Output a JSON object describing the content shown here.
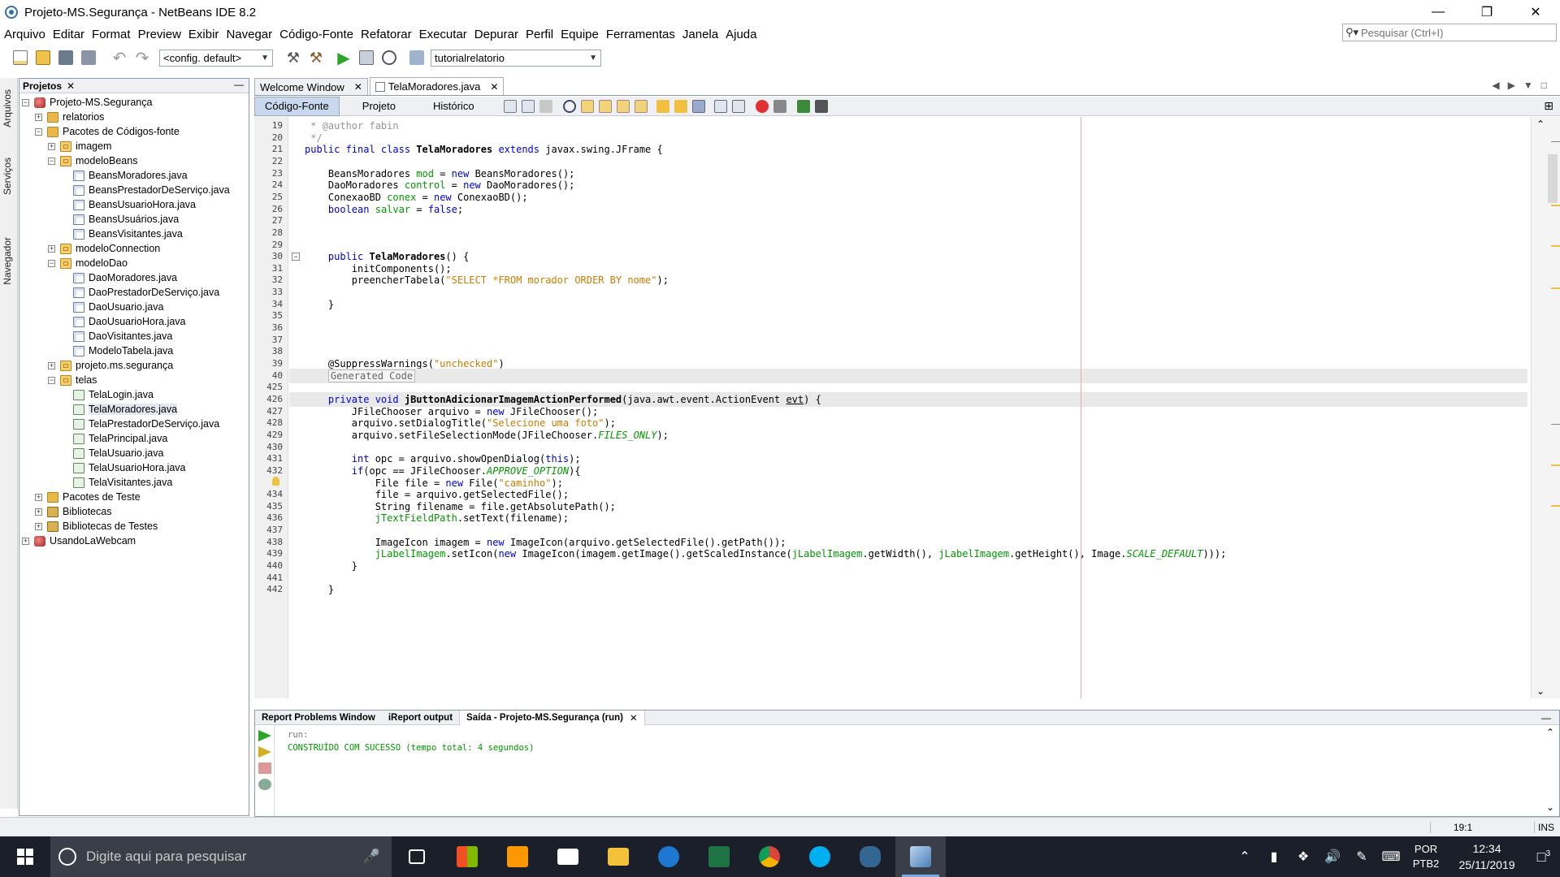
{
  "window": {
    "title": "Projeto-MS.Segurança - NetBeans IDE 8.2",
    "controls": [
      "—",
      "❐",
      "✕"
    ]
  },
  "menu": [
    "Arquivo",
    "Editar",
    "Format",
    "Preview",
    "Exibir",
    "Navegar",
    "Código-Fonte",
    "Refatorar",
    "Executar",
    "Depurar",
    "Perfil",
    "Equipe",
    "Ferramentas",
    "Janela",
    "Ajuda"
  ],
  "search": {
    "placeholder": "Pesquisar (Ctrl+I)"
  },
  "toolbar": {
    "config": "<config. default>",
    "project_combo": "tutorialrelatorio"
  },
  "side_tabs": [
    "Arquivos",
    "Serviços",
    "Navegador"
  ],
  "projects_panel": {
    "title": "Projetos",
    "close": "✕",
    "tree": [
      {
        "label": "Projeto-MS.Segurança",
        "depth": 0,
        "exp": "−",
        "icon": "proj"
      },
      {
        "label": "relatorios",
        "depth": 1,
        "exp": "+",
        "icon": "fold"
      },
      {
        "label": "Pacotes de Códigos-fonte",
        "depth": 1,
        "exp": "−",
        "icon": "fold"
      },
      {
        "label": "imagem",
        "depth": 2,
        "exp": "+",
        "icon": "pkg"
      },
      {
        "label": "modeloBeans",
        "depth": 2,
        "exp": "−",
        "icon": "pkg"
      },
      {
        "label": "BeansMoradores.java",
        "depth": 3,
        "exp": "",
        "icon": "java"
      },
      {
        "label": "BeansPrestadorDeServiço.java",
        "depth": 3,
        "exp": "",
        "icon": "java"
      },
      {
        "label": "BeansUsuarioHora.java",
        "depth": 3,
        "exp": "",
        "icon": "java"
      },
      {
        "label": "BeansUsuários.java",
        "depth": 3,
        "exp": "",
        "icon": "java"
      },
      {
        "label": "BeansVisitantes.java",
        "depth": 3,
        "exp": "",
        "icon": "java"
      },
      {
        "label": "modeloConnection",
        "depth": 2,
        "exp": "+",
        "icon": "pkg"
      },
      {
        "label": "modeloDao",
        "depth": 2,
        "exp": "−",
        "icon": "pkg"
      },
      {
        "label": "DaoMoradores.java",
        "depth": 3,
        "exp": "",
        "icon": "java"
      },
      {
        "label": "DaoPrestadorDeServiço.java",
        "depth": 3,
        "exp": "",
        "icon": "java"
      },
      {
        "label": "DaoUsuario.java",
        "depth": 3,
        "exp": "",
        "icon": "java"
      },
      {
        "label": "DaoUsuarioHora.java",
        "depth": 3,
        "exp": "",
        "icon": "java"
      },
      {
        "label": "DaoVisitantes.java",
        "depth": 3,
        "exp": "",
        "icon": "java"
      },
      {
        "label": "ModeloTabela.java",
        "depth": 3,
        "exp": "",
        "icon": "java"
      },
      {
        "label": "projeto.ms.segurança",
        "depth": 2,
        "exp": "+",
        "icon": "pkg"
      },
      {
        "label": "telas",
        "depth": 2,
        "exp": "−",
        "icon": "pkg"
      },
      {
        "label": "TelaLogin.java",
        "depth": 3,
        "exp": "",
        "icon": "form"
      },
      {
        "label": "TelaMoradores.java",
        "depth": 3,
        "exp": "",
        "icon": "form",
        "selected": true
      },
      {
        "label": "TelaPrestadorDeServiço.java",
        "depth": 3,
        "exp": "",
        "icon": "form"
      },
      {
        "label": "TelaPrincipal.java",
        "depth": 3,
        "exp": "",
        "icon": "form"
      },
      {
        "label": "TelaUsuario.java",
        "depth": 3,
        "exp": "",
        "icon": "form"
      },
      {
        "label": "TelaUsuarioHora.java",
        "depth": 3,
        "exp": "",
        "icon": "form"
      },
      {
        "label": "TelaVisitantes.java",
        "depth": 3,
        "exp": "",
        "icon": "form"
      },
      {
        "label": "Pacotes de Teste",
        "depth": 1,
        "exp": "+",
        "icon": "fold"
      },
      {
        "label": "Bibliotecas",
        "depth": 1,
        "exp": "+",
        "icon": "lib"
      },
      {
        "label": "Bibliotecas de Testes",
        "depth": 1,
        "exp": "+",
        "icon": "lib"
      },
      {
        "label": "UsandoLaWebcam",
        "depth": 0,
        "exp": "+",
        "icon": "proj"
      }
    ]
  },
  "editor": {
    "tabs": [
      {
        "label": "Welcome Window",
        "close": "✕"
      },
      {
        "label": "TelaMoradores.java",
        "close": "✕",
        "active": true
      }
    ],
    "subtabs": [
      "Código-Fonte",
      "Projeto",
      "Histórico"
    ],
    "fold_marks": {
      "30": "−",
      "40": "+",
      "426": "−"
    },
    "lines": [
      {
        "n": "19",
        "html": "<span class='cm'> * @author fabin</span>"
      },
      {
        "n": "20",
        "html": "<span class='cm'> */</span>"
      },
      {
        "n": "21",
        "html": "<span class='kw'>public final class</span> <b>TelaMoradores</b> <span class='kw'>extends</span> javax.swing.JFrame {"
      },
      {
        "n": "22",
        "html": ""
      },
      {
        "n": "23",
        "html": "    BeansMoradores <span class='gf'>mod</span> = <span class='kw'>new</span> BeansMoradores();"
      },
      {
        "n": "24",
        "html": "    DaoMoradores <span class='gf'>control</span> = <span class='kw'>new</span> DaoMoradores();"
      },
      {
        "n": "25",
        "html": "    ConexaoBD <span class='gf'>conex</span> = <span class='kw'>new</span> ConexaoBD();"
      },
      {
        "n": "26",
        "html": "    <span class='kw'>boolean</span> <span class='gf'>salvar</span> = <span class='kw'>false</span>;"
      },
      {
        "n": "27",
        "html": ""
      },
      {
        "n": "28",
        "html": ""
      },
      {
        "n": "29",
        "html": ""
      },
      {
        "n": "30",
        "html": "    <span class='kw'>public</span> <b>TelaMoradores</b>() {"
      },
      {
        "n": "31",
        "html": "        initComponents();"
      },
      {
        "n": "32",
        "html": "        preencherTabela(<span class='st'>\"SELECT *FROM morador ORDER BY nome\"</span>);"
      },
      {
        "n": "33",
        "html": ""
      },
      {
        "n": "34",
        "html": "    }"
      },
      {
        "n": "35",
        "html": ""
      },
      {
        "n": "36",
        "html": ""
      },
      {
        "n": "37",
        "html": ""
      },
      {
        "n": "38",
        "html": ""
      },
      {
        "n": "39",
        "html": "    @SuppressWarnings(<span class='st'>\"unchecked\"</span>)"
      },
      {
        "n": "40",
        "html": "    <span class='gc'>Generated Code</span>",
        "hl": true
      },
      {
        "n": "425",
        "html": ""
      },
      {
        "n": "426",
        "html": "    <span class='kw'>private void</span> <b>jButtonAdicionarImagemActionPerformed</b>(java.awt.event.ActionEvent <u>evt</u>) {",
        "hl": true
      },
      {
        "n": "427",
        "html": "        JFileChooser arquivo = <span class='kw'>new</span> JFileChooser();"
      },
      {
        "n": "428",
        "html": "        arquivo.setDialogTitle(<span class='st'>\"Selecione uma foto\"</span>);"
      },
      {
        "n": "429",
        "html": "        arquivo.setFileSelectionMode(JFileChooser.<span class='gi'>FILES_ONLY</span>);"
      },
      {
        "n": "430",
        "html": ""
      },
      {
        "n": "431",
        "html": "        <span class='kw'>int</span> opc = arquivo.showOpenDialog(<span class='kw'>this</span>);"
      },
      {
        "n": "432",
        "html": "        <span class='kw'>if</span>(opc == JFileChooser.<span class='gi'>APPROVE_OPTION</span>){"
      },
      {
        "n": "433",
        "html": "            File file = <span class='kw'>new</span> File(<span class='st'>\"caminho\"</span>);",
        "warn": true
      },
      {
        "n": "434",
        "html": "            file = arquivo.getSelectedFile();"
      },
      {
        "n": "435",
        "html": "            String filename = file.getAbsolutePath();"
      },
      {
        "n": "436",
        "html": "            <span class='gf'>jTextFieldPath</span>.setText(filename);"
      },
      {
        "n": "437",
        "html": ""
      },
      {
        "n": "438",
        "html": "            ImageIcon imagem = <span class='kw'>new</span> ImageIcon(arquivo.getSelectedFile().getPath());"
      },
      {
        "n": "439",
        "html": "            <span class='gf'>jLabelImagem</span>.setIcon(<span class='kw'>new</span> ImageIcon(imagem.getImage().getScaledInstance(<span class='gf'>jLabelImagem</span>.getWidth(), <span class='gf'>jLabelImagem</span>.getHeight(), Image.<span class='gi'>SCALE_DEFAULT</span>)));"
      },
      {
        "n": "440",
        "html": "        }"
      },
      {
        "n": "441",
        "html": ""
      },
      {
        "n": "442",
        "html": "    }"
      }
    ]
  },
  "output": {
    "tabs": [
      "Report Problems Window",
      "iReport output",
      "Saída - Projeto-MS.Segurança (run)"
    ],
    "close": "✕",
    "lines": [
      {
        "text": "run:",
        "color": "#777777"
      },
      {
        "text": "CONSTRUÍDO COM SUCESSO (tempo total: 4 segundos)",
        "color": "#009900"
      }
    ]
  },
  "status": {
    "position": "19:1",
    "mode": "INS"
  },
  "taskbar": {
    "search_placeholder": "Digite aqui para pesquisar",
    "lang": "POR",
    "lang2": "PTB2",
    "time": "12:34",
    "date": "25/11/2019",
    "notif_count": "3"
  },
  "colors": {
    "keyword": "#0000e6",
    "string": "#ce7b00",
    "field": "#009900",
    "comment": "#969696"
  }
}
